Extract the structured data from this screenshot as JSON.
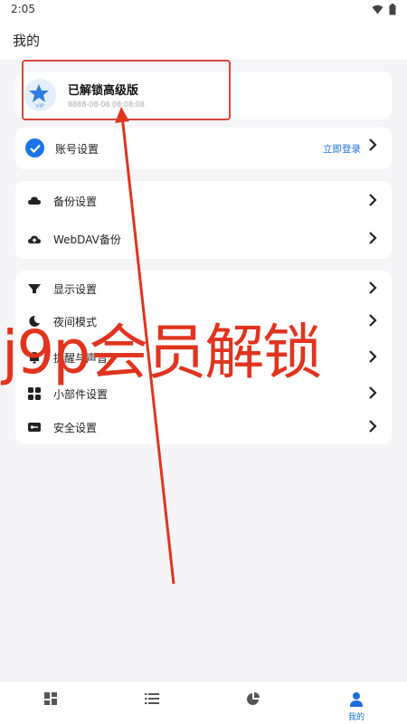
{
  "status_bar": {
    "time": "2:05",
    "icons": [
      "wifi-icon",
      "battery-icon"
    ]
  },
  "header": {
    "title": "我的"
  },
  "vip": {
    "title": "已解锁高级版",
    "date": "8888-08-08 08:08:08",
    "badge_text": "VIP"
  },
  "account": {
    "label": "账号设置",
    "action": "立即登录"
  },
  "backup_group": [
    {
      "label": "备份设置",
      "icon": "cloud-icon"
    },
    {
      "label": "WebDAV备份",
      "icon": "cloud-upload-icon"
    }
  ],
  "settings_group": [
    {
      "label": "显示设置",
      "icon": "funnel-icon"
    },
    {
      "label": "夜间模式",
      "icon": "moon-icon"
    },
    {
      "label": "提醒与声音",
      "icon": "bell-icon"
    },
    {
      "label": "小部件设置",
      "icon": "grid-icon"
    },
    {
      "label": "安全设置",
      "icon": "key-icon"
    }
  ],
  "bottom_nav": [
    {
      "icon": "dashboard-icon",
      "label": ""
    },
    {
      "icon": "list-icon",
      "label": ""
    },
    {
      "icon": "pie-chart-icon",
      "label": ""
    },
    {
      "icon": "person-icon",
      "label": "我的"
    }
  ],
  "overlay": {
    "watermark": "j9p会员解锁"
  },
  "colors": {
    "accent": "#1a6fd8",
    "annotation": "#e0341f",
    "background": "#f5f5f7"
  }
}
